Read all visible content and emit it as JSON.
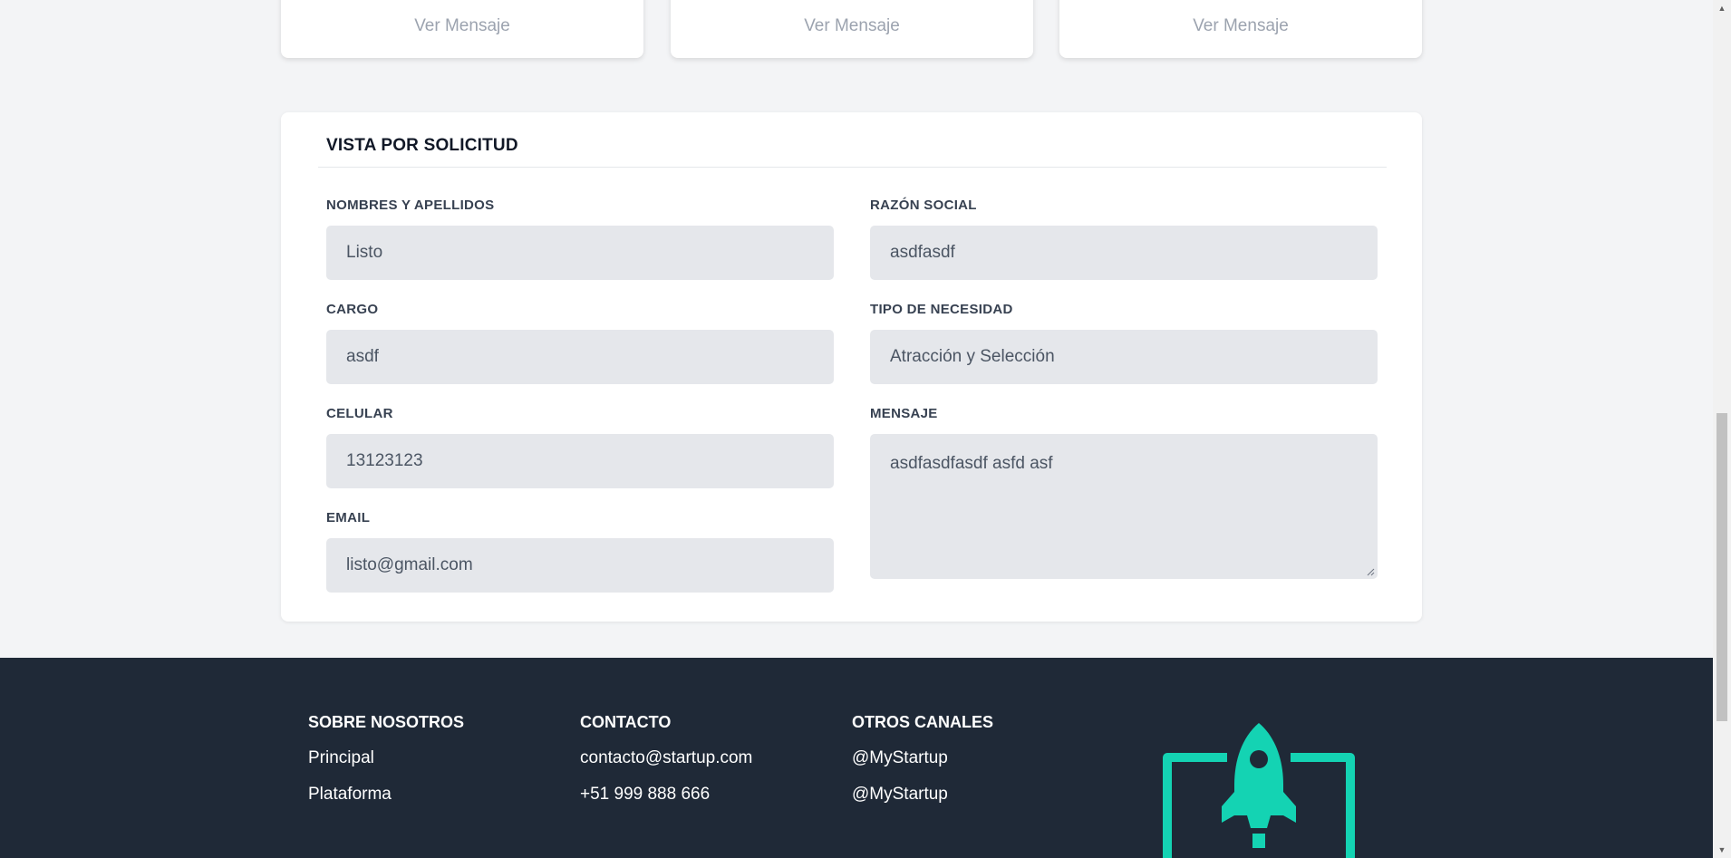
{
  "message_cards": [
    {
      "link_label": "Ver Mensaje"
    },
    {
      "link_label": "Ver Mensaje"
    },
    {
      "link_label": "Ver Mensaje"
    }
  ],
  "request_view": {
    "title": "VISTA POR SOLICITUD",
    "fields": {
      "nombres": {
        "label": "NOMBRES Y APELLIDOS",
        "value": "Listo"
      },
      "razon_social": {
        "label": "RAZÓN SOCIAL",
        "value": "asdfasdf"
      },
      "cargo": {
        "label": "CARGO",
        "value": "asdf"
      },
      "tipo_necesidad": {
        "label": "TIPO DE NECESIDAD",
        "value": "Atracción y Selección"
      },
      "celular": {
        "label": "CELULAR",
        "value": "13123123"
      },
      "mensaje": {
        "label": "MENSAJE",
        "value": "asdfasdfasdf asfd asf"
      },
      "email": {
        "label": "EMAIL",
        "value": "listo@gmail.com"
      }
    }
  },
  "footer": {
    "about": {
      "heading": "SOBRE NOSOTROS",
      "links": [
        "Principal",
        "Plataforma"
      ]
    },
    "contact": {
      "heading": "CONTACTO",
      "links": [
        "contacto@startup.com",
        "+51 999 888 666"
      ]
    },
    "channels": {
      "heading": "OTROS CANALES",
      "links": [
        "@MyStartup",
        "@MyStartup"
      ]
    },
    "logo_icon": "rocket-icon",
    "background_color": "#1f2937",
    "accent_color": "#14d3b3"
  }
}
